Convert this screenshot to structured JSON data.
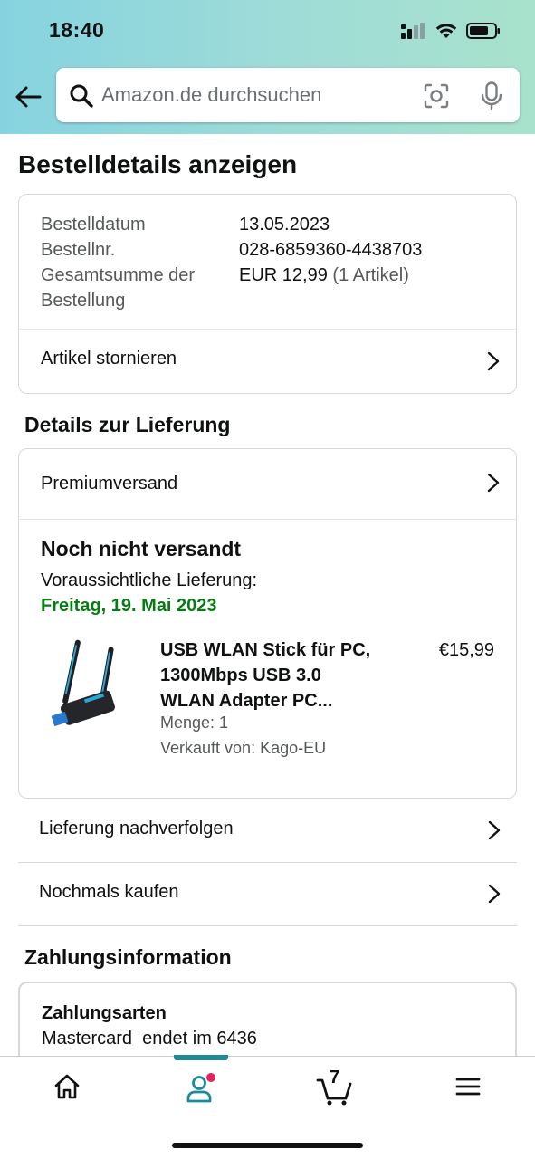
{
  "status_bar": {
    "time": "18:40"
  },
  "search": {
    "placeholder": "Amazon.de durchsuchen"
  },
  "page_title": "Bestelldetails anzeigen",
  "order_summary": {
    "date_label": "Bestelldatum",
    "date_value": "13.05.2023",
    "number_label": "Bestellnr.",
    "number_value": "028-6859360-4438703",
    "total_label_line1": "Gesamtsumme der",
    "total_label_line2": "Bestellung",
    "total_value": "EUR 12,99",
    "total_items": "(1 Artikel)",
    "cancel_label": "Artikel stornieren"
  },
  "delivery": {
    "heading": "Details zur Lieferung",
    "shipping_method": "Premiumversand",
    "status": "Noch nicht versandt",
    "expected_label": "Voraussichtliche Lieferung:",
    "expected_date": "Freitag, 19. Mai 2023",
    "product": {
      "title_line1": "USB WLAN Stick für PC,",
      "title_line2": "1300Mbps USB 3.0",
      "title_line3": "WLAN Adapter PC...",
      "price": "€15,99",
      "quantity": "Menge: 1",
      "seller": "Verkauft von: Kago-EU"
    }
  },
  "actions": {
    "track": "Lieferung nachverfolgen",
    "buy_again": "Nochmals kaufen"
  },
  "payment": {
    "heading": "Zahlungsinformation",
    "methods_label": "Zahlungsarten",
    "card_text": "Mastercard  endet im 6436"
  },
  "tabbar": {
    "cart_count": "7",
    "active_tab": "account",
    "accent_color": "#1d8a99",
    "notification_color": "#e0245e"
  },
  "colors": {
    "delivery_date_green": "#067d10",
    "header_gradient_start": "#86d3e0",
    "header_gradient_end": "#a8e2cc"
  }
}
